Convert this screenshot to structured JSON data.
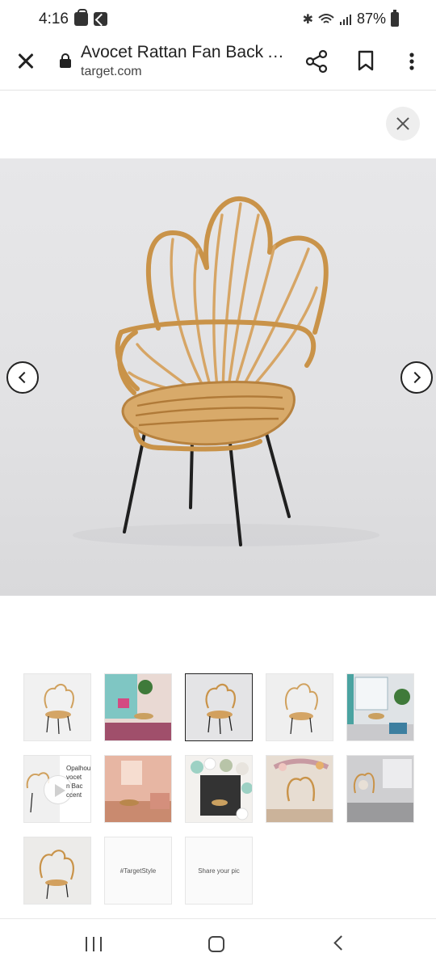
{
  "status_bar": {
    "time": "4:16",
    "battery": "87%",
    "icons": [
      "shopping-bag-icon",
      "app-icon",
      "bluetooth-icon",
      "wifi-icon",
      "signal-icon",
      "battery-icon"
    ]
  },
  "toolbar": {
    "title": "Avocet Rattan Fan Back Accent Chair",
    "url": "target.com",
    "icons": [
      "close-icon",
      "lock-icon",
      "share-icon",
      "bookmark-icon",
      "more-vert-icon"
    ]
  },
  "gallery": {
    "selected_index": 2,
    "thumbnails": [
      {
        "kind": "chair-white"
      },
      {
        "kind": "lifestyle-teal"
      },
      {
        "kind": "chair-gray",
        "selected": true
      },
      {
        "kind": "chair-white"
      },
      {
        "kind": "lifestyle-room"
      },
      {
        "kind": "video",
        "text": "Opalhou\nvocet\nn Bac\nccent"
      },
      {
        "kind": "lifestyle-pink"
      },
      {
        "kind": "lifestyle-balloons"
      },
      {
        "kind": "lifestyle-flowers"
      },
      {
        "kind": "lifestyle-corner"
      },
      {
        "kind": "lifestyle-gray"
      },
      {
        "kind": "text",
        "text": "#TargetStyle"
      },
      {
        "kind": "text",
        "text": "Share your pic"
      }
    ]
  },
  "colors": {
    "rattan": "#d2a05e",
    "rattan_dark": "#b7823f",
    "leg": "#1f1f1f",
    "background": "#e4e4e6"
  }
}
